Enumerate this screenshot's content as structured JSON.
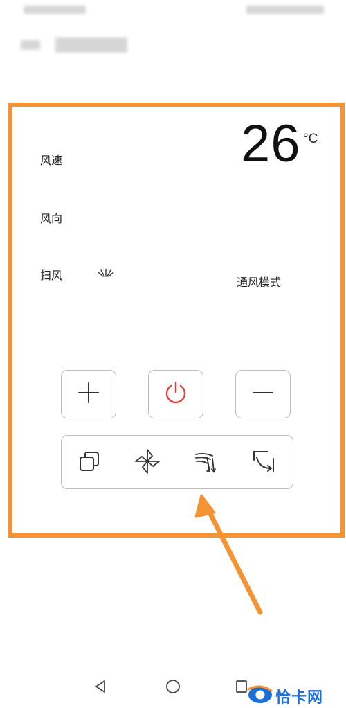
{
  "panel": {
    "labels": {
      "wind_speed": "风速",
      "wind_direction": "风向",
      "swing": "扫风",
      "mode": "通风模式"
    },
    "temperature": {
      "value": "26",
      "unit": "°C"
    }
  },
  "controls": {
    "increase_icon": "plus-icon",
    "power_icon": "power-icon",
    "decrease_icon": "minus-icon",
    "bottom_bar_icons": [
      "copy-mode-icon",
      "fan-icon",
      "swing-direction-icon",
      "rotate-icon"
    ]
  },
  "navbar": {
    "icons": [
      "back-icon",
      "home-icon",
      "recents-icon"
    ]
  },
  "watermark": {
    "text": "恰卡网"
  },
  "colors": {
    "highlight_border": "#f39333",
    "power_icon": "#e2403a",
    "button_border": "#bdbdbd",
    "watermark": "#1c6fd8"
  }
}
